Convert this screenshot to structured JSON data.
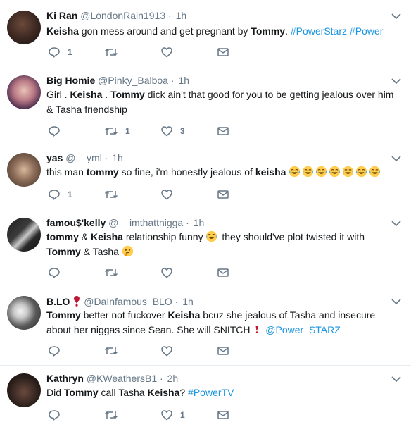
{
  "tweets": [
    {
      "name": "Ki Ran",
      "handle": "@LondonRain1913",
      "dot": "·",
      "time": "1h",
      "text": [
        {
          "t": "Keisha",
          "b": true
        },
        {
          "t": " gon mess around and get pregnant by "
        },
        {
          "t": "Tommy",
          "b": true
        },
        {
          "t": ".  "
        },
        {
          "t": "#PowerStarz",
          "tag": true
        },
        {
          "t": " "
        },
        {
          "t": "#Power",
          "tag": true
        }
      ],
      "reply_count": "1",
      "retweet_count": "",
      "like_count": ""
    },
    {
      "name": "Big Homie",
      "handle": "@Pinky_Balboa",
      "dot": "·",
      "time": "1h",
      "text": [
        {
          "t": "Girl . "
        },
        {
          "t": "Keisha",
          "b": true
        },
        {
          "t": " . "
        },
        {
          "t": "Tommy",
          "b": true
        },
        {
          "t": " dick ain't that good for you to be getting jealous over him & Tasha friendship"
        }
      ],
      "reply_count": "",
      "retweet_count": "1",
      "like_count": "3"
    },
    {
      "name": "yas",
      "handle": "@__yml",
      "dot": "·",
      "time": "1h",
      "text": [
        {
          "t": "this man "
        },
        {
          "t": "tommy",
          "b": true
        },
        {
          "t": " so fine, i'm honestly jealous of "
        },
        {
          "t": "keisha",
          "b": true
        },
        {
          "t": " "
        },
        {
          "emoji": "laugh",
          "n": 7
        }
      ],
      "reply_count": "1",
      "retweet_count": "",
      "like_count": ""
    },
    {
      "name": "famou$'kelly",
      "handle": "@__imthattnigga",
      "dot": "·",
      "time": "1h",
      "text": [
        {
          "t": "tommy",
          "b": true
        },
        {
          "t": " & "
        },
        {
          "t": "Keisha",
          "b": true
        },
        {
          "t": " relationship funny "
        },
        {
          "emoji": "laugh",
          "n": 1
        },
        {
          "t": " they should've plot twisted it with "
        },
        {
          "t": "Tommy",
          "b": true
        },
        {
          "t": " & Tasha "
        },
        {
          "emoji": "think",
          "n": 1
        }
      ],
      "reply_count": "",
      "retweet_count": "",
      "like_count": ""
    },
    {
      "name": "B.LO",
      "name_emoji": "heart",
      "handle": "@DaInfamous_BLO",
      "dot": "·",
      "time": "1h",
      "text": [
        {
          "t": "Tommy",
          "b": true
        },
        {
          "t": " better not fuckover "
        },
        {
          "t": "Keisha",
          "b": true
        },
        {
          "t": " bcuz she jealous of Tasha and insecure about her niggas since Sean. She will SNITCH "
        },
        {
          "emoji": "exclaim",
          "n": 1
        },
        {
          "t": " "
        },
        {
          "t": "@Power_STARZ",
          "tag": true
        }
      ],
      "reply_count": "",
      "retweet_count": "",
      "like_count": ""
    },
    {
      "name": "Kathryn",
      "handle": "@KWeathersB1",
      "dot": "·",
      "time": "2h",
      "text": [
        {
          "t": "Did "
        },
        {
          "t": "Tommy",
          "b": true
        },
        {
          "t": " call Tasha "
        },
        {
          "t": "Keisha",
          "b": true
        },
        {
          "t": "? "
        },
        {
          "t": "#PowerTV",
          "tag": true
        }
      ],
      "reply_count": "",
      "retweet_count": "",
      "like_count": "1"
    }
  ],
  "colors": {
    "text": "#14171a",
    "muted": "#657786",
    "link": "#1b95e0",
    "divider": "#e6ecf0"
  },
  "icons": [
    "reply-icon",
    "retweet-icon",
    "like-icon",
    "direct-message-icon",
    "caret-down-icon"
  ]
}
